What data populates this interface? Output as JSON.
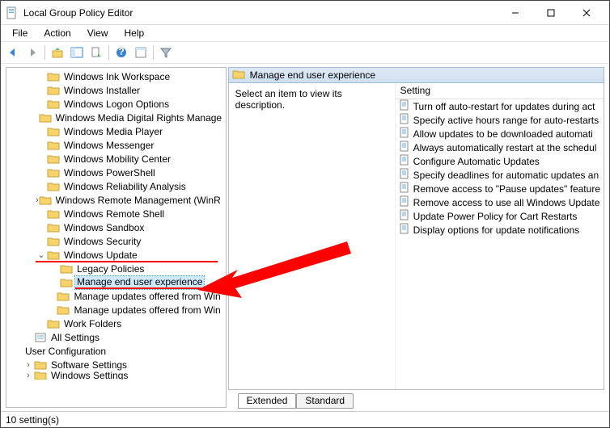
{
  "window": {
    "title": "Local Group Policy Editor"
  },
  "menu": {
    "file": "File",
    "action": "Action",
    "view": "View",
    "help": "Help"
  },
  "tree": {
    "items": [
      {
        "indent": 2,
        "exp": "",
        "label": "Windows Ink Workspace"
      },
      {
        "indent": 2,
        "exp": "",
        "label": "Windows Installer"
      },
      {
        "indent": 2,
        "exp": "",
        "label": "Windows Logon Options"
      },
      {
        "indent": 2,
        "exp": "",
        "label": "Windows Media Digital Rights Manage"
      },
      {
        "indent": 2,
        "exp": "",
        "label": "Windows Media Player"
      },
      {
        "indent": 2,
        "exp": "",
        "label": "Windows Messenger"
      },
      {
        "indent": 2,
        "exp": "",
        "label": "Windows Mobility Center"
      },
      {
        "indent": 2,
        "exp": "",
        "label": "Windows PowerShell"
      },
      {
        "indent": 2,
        "exp": "",
        "label": "Windows Reliability Analysis"
      },
      {
        "indent": 2,
        "exp": ">",
        "label": "Windows Remote Management (WinR"
      },
      {
        "indent": 2,
        "exp": "",
        "label": "Windows Remote Shell"
      },
      {
        "indent": 2,
        "exp": "",
        "label": "Windows Sandbox"
      },
      {
        "indent": 2,
        "exp": "",
        "label": "Windows Security"
      },
      {
        "indent": 2,
        "exp": "v",
        "label": "Windows Update",
        "redline": true
      },
      {
        "indent": 3,
        "exp": "",
        "label": "Legacy Policies"
      },
      {
        "indent": 3,
        "exp": "",
        "label": "Manage end user experience",
        "selected": true,
        "redline2": true
      },
      {
        "indent": 3,
        "exp": "",
        "label": "Manage updates offered from Win"
      },
      {
        "indent": 3,
        "exp": "",
        "label": "Manage updates offered from Win"
      },
      {
        "indent": 2,
        "exp": "",
        "label": "Work Folders"
      },
      {
        "indent": 1,
        "exp": "",
        "label": "All Settings",
        "icon": "allsettings"
      },
      {
        "indent": 0,
        "exp": "",
        "label": "User Configuration",
        "icon": "none"
      },
      {
        "indent": 1,
        "exp": ">",
        "label": "Software Settings"
      },
      {
        "indent": 1,
        "exp": ">",
        "label": "Windows Settings",
        "cut": true
      }
    ]
  },
  "detail": {
    "header": "Manage end user experience",
    "description": "Select an item to view its description.",
    "column": "Setting",
    "items": [
      "Turn off auto-restart for updates during act",
      "Specify active hours range for auto-restarts",
      "Allow updates to be downloaded automati",
      "Always automatically restart at the schedul",
      "Configure Automatic Updates",
      "Specify deadlines for automatic updates an",
      "Remove access to \"Pause updates\" feature",
      "Remove access to use all Windows Update",
      "Update Power Policy for Cart Restarts",
      "Display options for update notifications"
    ]
  },
  "tabs": {
    "extended": "Extended",
    "standard": "Standard"
  },
  "status": "10 setting(s)"
}
